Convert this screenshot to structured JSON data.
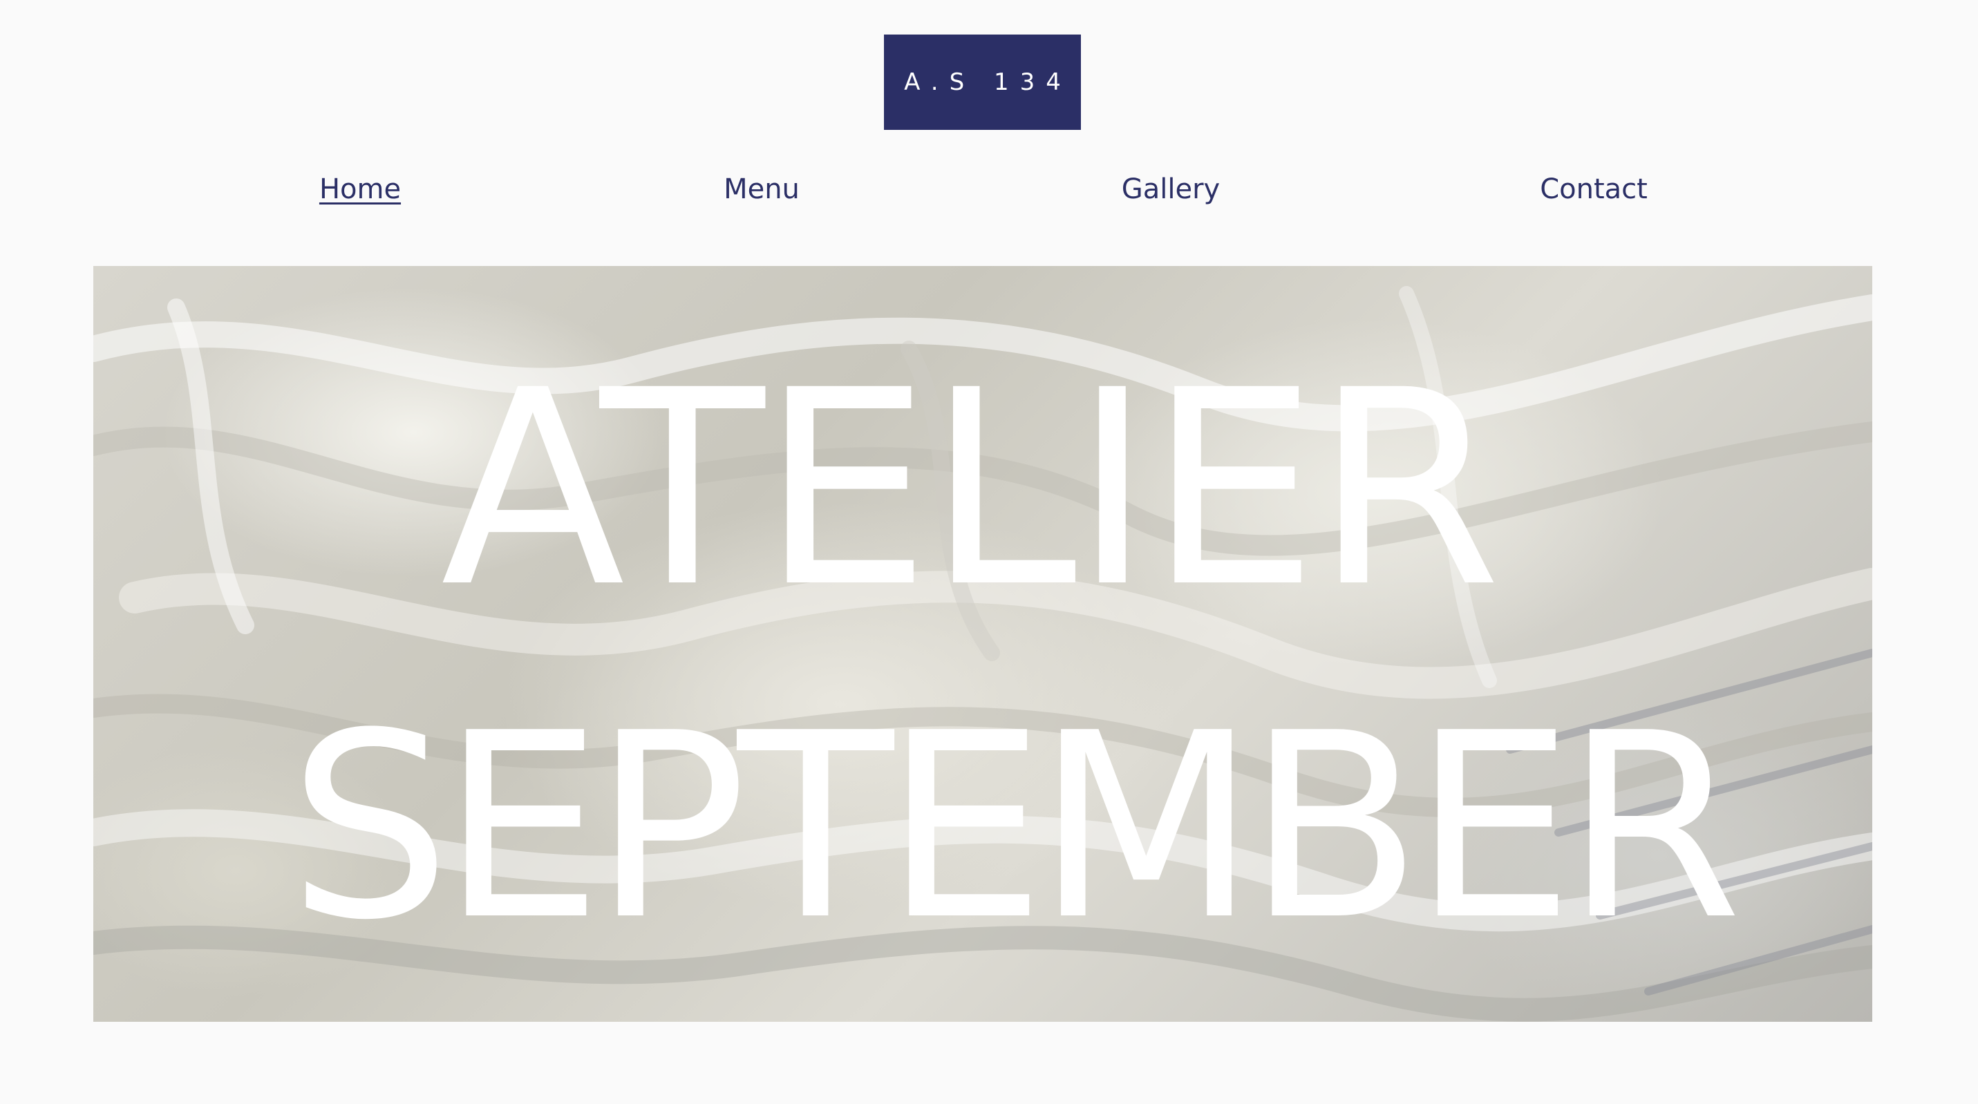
{
  "header": {
    "logo_text": "A.S 134"
  },
  "nav": {
    "items": [
      {
        "label": "Home",
        "active": true
      },
      {
        "label": "Menu",
        "active": false
      },
      {
        "label": "Gallery",
        "active": false
      },
      {
        "label": "Contact",
        "active": false
      }
    ]
  },
  "hero": {
    "line1": "ATELIER",
    "line2": "SEPTEMBER"
  },
  "colors": {
    "brand": "#2b2f66",
    "background": "#fafafa",
    "hero_text": "#ffffff"
  }
}
